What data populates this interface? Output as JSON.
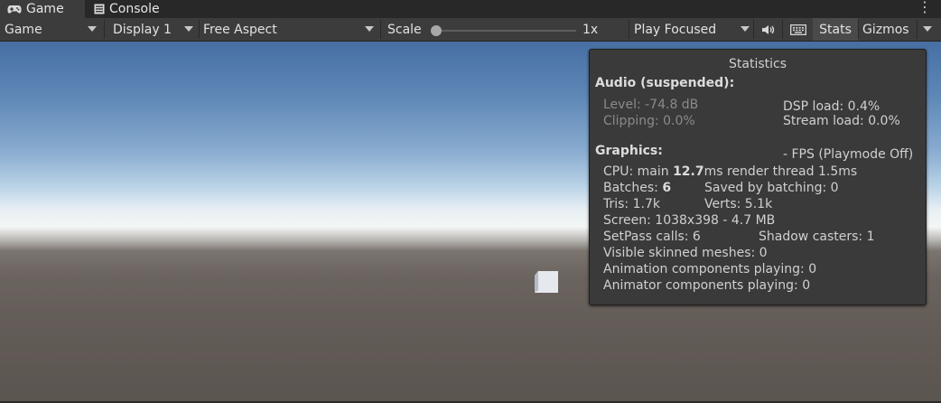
{
  "tabs": [
    {
      "label": "Game",
      "icon": "gamepad-icon",
      "active": true
    },
    {
      "label": "Console",
      "icon": "console-icon",
      "active": false
    }
  ],
  "toolbar": {
    "view": "Game",
    "display": "Display 1",
    "aspect": "Free Aspect",
    "scale_label": "Scale",
    "scale_value": "1x",
    "play_mode": "Play Focused",
    "stats_label": "Stats",
    "gizmos_label": "Gizmos"
  },
  "stats": {
    "title": "Statistics",
    "audio": {
      "header": "Audio (suspended):",
      "level": "Level: -74.8 dB",
      "clipping": "Clipping: 0.0%",
      "dsp": "DSP load: 0.4%",
      "stream": "Stream load: 0.0%"
    },
    "graphics": {
      "header": "Graphics:",
      "fps": "- FPS (Playmode Off)",
      "cpu_prefix": "CPU: main ",
      "cpu_main": "12.7",
      "cpu_suffix": "ms  render thread 1.5ms",
      "batches_prefix": "Batches: ",
      "batches": "6",
      "saved": "Saved by batching: 0",
      "tris": "Tris: 1.7k",
      "verts": "Verts: 5.1k",
      "screen": "Screen: 1038x398 - 4.7 MB",
      "setpass": "SetPass calls: 6",
      "shadow": "Shadow casters: 1",
      "skinned": "Visible skinned meshes: 0",
      "animation": "Animation components playing: 0",
      "animator": "Animator components playing: 0"
    }
  }
}
